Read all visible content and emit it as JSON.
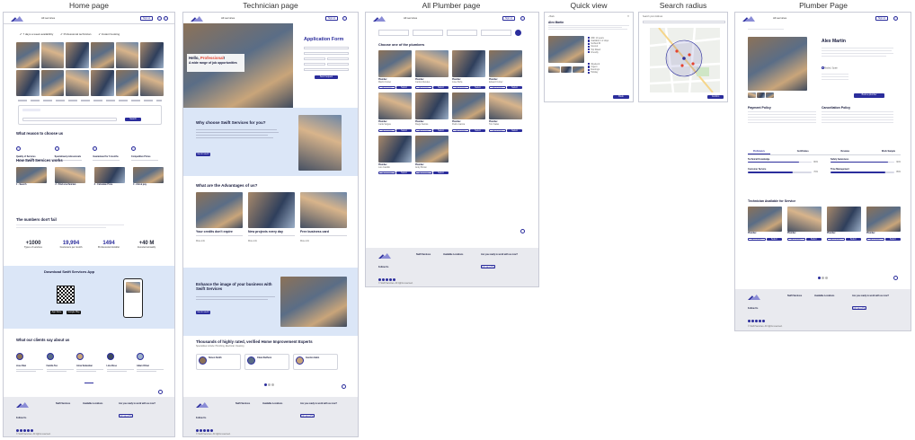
{
  "titles": {
    "home": "Home page",
    "tech": "Technician page",
    "all": "All Plumber page",
    "quick": "Quick view",
    "radius": "Search radius",
    "plumber": "Plumber Page"
  },
  "nav": {
    "services": "All services",
    "cta": "Sign up"
  },
  "home": {
    "features": [
      "7 days a week availability",
      "Professional technician",
      "Instant booking"
    ],
    "search_button": "Search",
    "reasons_title": "What reason to choose us",
    "reasons": [
      "Quality of Services",
      "Specialised professionals",
      "Guaranteed for 6 months",
      "Competitive Prices"
    ],
    "works_title": "How Swift Services works",
    "steps": [
      "1 - Search",
      "2 - Find a technician",
      "3 - Calculate Price",
      "4 - Ask & pay"
    ],
    "numbers_title": "The numbers don't fail",
    "stats": [
      {
        "value": "+1000",
        "label": "Types of services"
      },
      {
        "value": "19,994",
        "label": "Customers per month"
      },
      {
        "value": "1494",
        "label": "Professional installer"
      },
      {
        "value": "+40 M",
        "label": "Invested annually"
      }
    ],
    "app_title": "Download Swift Services App",
    "store1": "App Store",
    "store2": "Google Play",
    "clients_title": "What our clients say about us",
    "reviewers": [
      "Jose Diaz",
      "Camila Teo",
      "Anna Sebastian",
      "Lina Rose",
      "Adam Oliver"
    ]
  },
  "tech": {
    "hero_hello": "Hello,",
    "hero_role": "Professional",
    "hero_bang": "!",
    "hero_sub": "A wide range of job opportunities",
    "form_title": "Application Form",
    "submit": "Send request",
    "why_title": "Why choose Swift Services for you?",
    "why_btn": "Get in touch",
    "adv_title": "What are the Advantages of us?",
    "adv": [
      "Your credits don't expire",
      "New projects every day",
      "Free business card"
    ],
    "more": "More info",
    "enhance_title": "Enhance the image of your business with Swift Services",
    "enhance_btn": "Get in touch",
    "thousands_title": "Thousands of highly rated, verified Home Improvement Experts",
    "thousands_sub": "Specialities include: Plumbing, Electrical, Cleaning",
    "experts": [
      "Simon Smith",
      "Clara Steffenn",
      "Gordon Hahn"
    ]
  },
  "all": {
    "choose_title": "Choose one of the plumbers",
    "card_label": "Plumber",
    "names": [
      "Martin Foster",
      "Carlos Mendes",
      "Jose Peña",
      "Eduard Cortez",
      "Carla Vargas",
      "Diego Santos",
      "Pedro Garcia",
      "Tom Salas",
      "Luis Castillo",
      "Andy Brown"
    ],
    "view": "View more",
    "select": "Select"
  },
  "quick": {
    "name": "Alex Martin",
    "back": "Back",
    "options": [
      "Weekend",
      "Urgent",
      "Evenings",
      "Holiday"
    ],
    "book": "Book",
    "info": [
      "With 10 years",
      "Available in 2 days",
      "Verified ID",
      "Insured",
      "Top Rated",
      "Friendly"
    ]
  },
  "radius": {
    "label": "Search your Address",
    "confirm": "Confirm"
  },
  "plumber": {
    "name": "Alex Martin",
    "location": "Madrid, Spain",
    "detail_btn": "Book a plumber",
    "payment_title": "Payment Policy",
    "cancel_title": "Cancellation Policy",
    "tabs": [
      "Proficiency",
      "Certificates",
      "Reviews",
      "Work Sample"
    ],
    "skills": [
      {
        "name": "Technical Knowledge",
        "value": 80
      },
      {
        "name": "Safety Awareness",
        "value": 90
      },
      {
        "name": "Customer Service",
        "value": 70
      },
      {
        "name": "Time Management",
        "value": 85
      }
    ],
    "skill_labels": [
      "80%",
      "90%",
      "70%",
      "85%"
    ],
    "avail_title": "Technician Available for Service",
    "others": [
      "Plumber",
      "Plumber",
      "Plumber",
      "Plumber"
    ]
  },
  "footer": {
    "follow": "Follow Us",
    "col1": "Swift Services",
    "col2": "Available Locations",
    "col3": "Are you ready to work with us now?",
    "cta": "Join as a Pro",
    "links": [
      "About Us",
      "Job Opportunity",
      "Become A Pro",
      "Terms of Use"
    ],
    "locs": [
      "Chicago",
      "New York",
      "LA",
      "Texas"
    ],
    "copy": "© Swift Services. All rights reserved."
  }
}
